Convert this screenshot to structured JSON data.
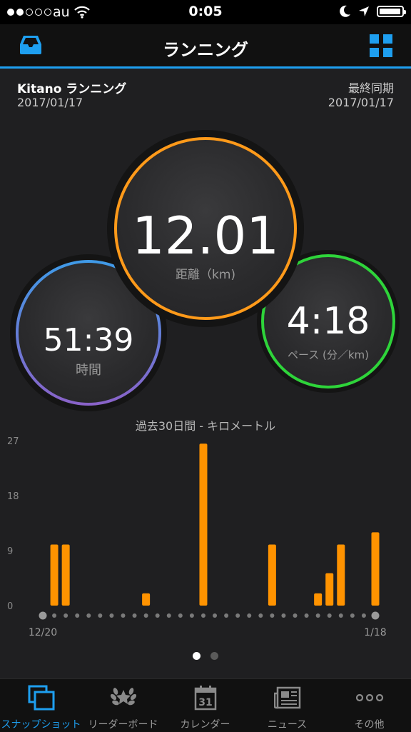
{
  "status_bar": {
    "carrier": "au",
    "time": "0:05"
  },
  "nav": {
    "title": "ランニング"
  },
  "info": {
    "name": "Kitano ランニング",
    "date": "2017/01/17",
    "sync_label": "最終同期",
    "sync_date": "2017/01/17"
  },
  "stats": {
    "distance": {
      "value": "12.01",
      "label": "距離（km)",
      "color": "#ff9a1a"
    },
    "time": {
      "value": "51:39",
      "label": "時間",
      "color_start": "#3f9be8",
      "color_end": "#8a62c8"
    },
    "pace": {
      "value": "4:18",
      "label": "ペース (分／km)",
      "color": "#2ed43a"
    }
  },
  "chart_title": "過去30日間 - キロメートル",
  "chart_data": {
    "type": "bar",
    "ylim": [
      0,
      27
    ],
    "y_ticks": [
      "27",
      "18",
      "9",
      "0"
    ],
    "x_start_label": "12/20",
    "x_end_label": "1/18",
    "days": 30,
    "values": [
      0,
      10,
      10,
      0,
      0,
      0,
      0,
      0,
      0,
      2,
      0,
      0,
      0,
      0,
      26.5,
      0,
      0,
      0,
      0,
      0,
      10,
      0,
      0,
      0,
      2,
      5.3,
      10,
      0,
      0,
      12
    ],
    "bar_color": "#ff9300"
  },
  "pager": {
    "count": 2,
    "active": 0
  },
  "tabs": [
    {
      "label": "スナップショット",
      "icon": "snapshot-icon",
      "active": true
    },
    {
      "label": "リーダーボード",
      "icon": "laurel-icon",
      "active": false
    },
    {
      "label": "カレンダー",
      "icon": "calendar-icon",
      "active": false,
      "icon_text": "31"
    },
    {
      "label": "ニュース",
      "icon": "newspaper-icon",
      "active": false
    },
    {
      "label": "その他",
      "icon": "more-icon",
      "active": false,
      "icon_text": "ooo"
    }
  ]
}
